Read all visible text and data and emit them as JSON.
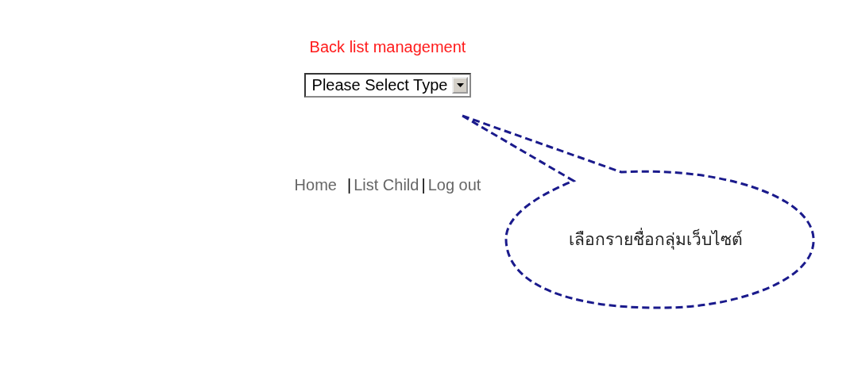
{
  "page_title": "Back list management",
  "type_select": {
    "value": "Please Select Type"
  },
  "nav": {
    "separator": "|",
    "items": [
      {
        "label": "Home"
      },
      {
        "label": "List Child"
      },
      {
        "label": "Log out"
      }
    ]
  },
  "callout": {
    "text": "เลือกรายชื่อกลุ่มเว็บไซต์"
  }
}
